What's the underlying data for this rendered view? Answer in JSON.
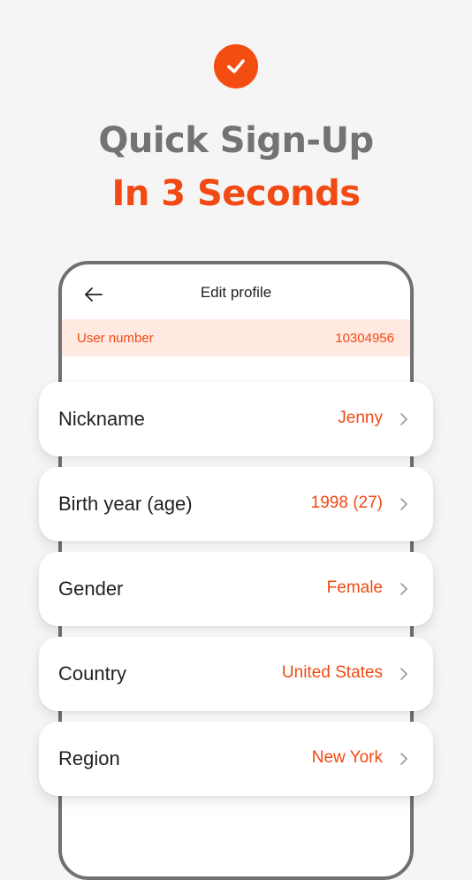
{
  "colors": {
    "accent": "#f24a14",
    "headline_gray": "#737373",
    "user_strip_bg": "#ffe9e1"
  },
  "hero": {
    "check_icon": "check-circle-icon",
    "line1": "Quick Sign-Up",
    "line2": "In 3 Seconds"
  },
  "screen": {
    "back_icon": "arrow-left-icon",
    "title": "Edit profile",
    "user_number_label": "User number",
    "user_number_value": "10304956"
  },
  "fields": [
    {
      "label": "Nickname",
      "value": "Jenny"
    },
    {
      "label": "Birth year (age)",
      "value": "1998 (27)"
    },
    {
      "label": "Gender",
      "value": "Female"
    },
    {
      "label": "Country",
      "value": "United States"
    },
    {
      "label": "Region",
      "value": "New York"
    }
  ],
  "chevron_icon": "chevron-right-icon"
}
